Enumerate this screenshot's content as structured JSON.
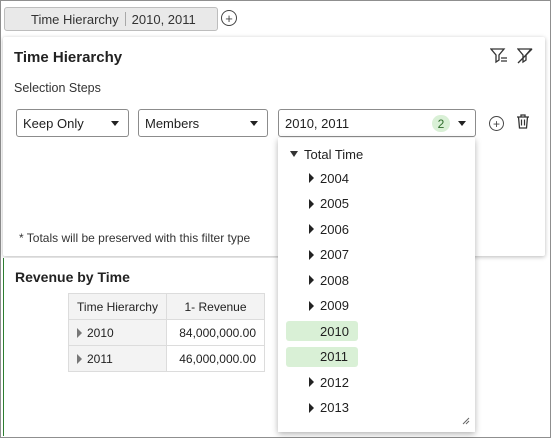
{
  "filter_bar": {
    "chip_name": "Time Hierarchy",
    "chip_value": "2010, 2011"
  },
  "panel": {
    "title": "Time Hierarchy",
    "section_label": "Selection Steps",
    "step": {
      "action": "Keep Only",
      "type": "Members",
      "values": "2010, 2011",
      "count": "2"
    },
    "note": "* Totals will be preserved with this filter type"
  },
  "report": {
    "title": "Revenue by Time",
    "columns": [
      "Time Hierarchy",
      "1- Revenue"
    ],
    "rows": [
      {
        "member": "2010",
        "revenue": "84,000,000.00"
      },
      {
        "member": "2011",
        "revenue": "46,000,000.00"
      }
    ]
  },
  "dropdown": {
    "root": "Total Time",
    "items": [
      {
        "label": "2004",
        "selected": false
      },
      {
        "label": "2005",
        "selected": false
      },
      {
        "label": "2006",
        "selected": false
      },
      {
        "label": "2007",
        "selected": false
      },
      {
        "label": "2008",
        "selected": false
      },
      {
        "label": "2009",
        "selected": false
      },
      {
        "label": "2010",
        "selected": true
      },
      {
        "label": "2011",
        "selected": true
      },
      {
        "label": "2012",
        "selected": false
      },
      {
        "label": "2013",
        "selected": false
      }
    ]
  },
  "colors": {
    "selected_highlight": "#d9f0d6",
    "badge_text": "#2e6b2b",
    "report_accent": "#2e7d32"
  }
}
